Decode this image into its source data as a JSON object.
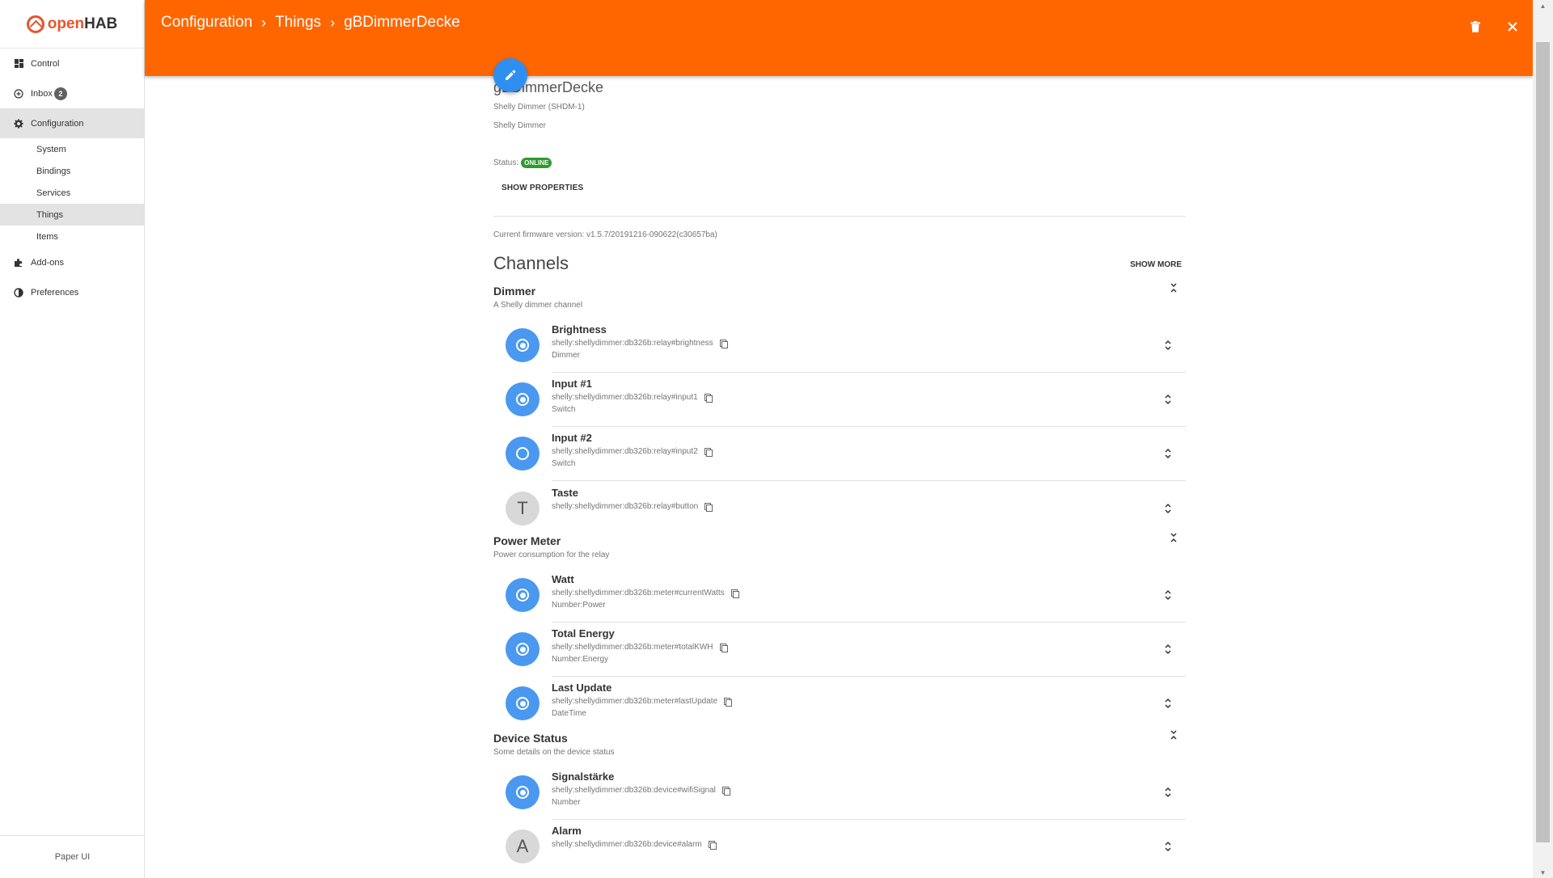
{
  "app": {
    "logo_text_open": "open",
    "logo_text_hab": "HAB",
    "footer": "Paper UI",
    "accent": "#ff6600",
    "primary_blue": "#4a98f0"
  },
  "sidebar": {
    "items": [
      {
        "label": "Control",
        "icon": "dashboard-icon"
      },
      {
        "label": "Inbox",
        "icon": "plus-circle-icon",
        "badge": "2"
      },
      {
        "label": "Configuration",
        "icon": "gear-icon"
      },
      {
        "label": "Add-ons",
        "icon": "puzzle-icon"
      },
      {
        "label": "Preferences",
        "icon": "contrast-icon"
      }
    ],
    "sub_items": [
      "System",
      "Bindings",
      "Services",
      "Things",
      "Items"
    ]
  },
  "header": {
    "crumbs": [
      "Configuration",
      "Things",
      "gBDimmerDecke"
    ],
    "separator": "›"
  },
  "thing": {
    "title": "gBDimmerDecke",
    "type_label": "Shelly Dimmer (SHDM-1)",
    "description": "Shelly Dimmer",
    "status_label": "Status:",
    "status": "ONLINE",
    "show_properties": "SHOW PROPERTIES",
    "firmware": "Current firmware version:  v1.5.7/20191216-090622(c30657ba)"
  },
  "channels": {
    "title": "Channels",
    "show_more": "SHOW MORE",
    "groups": [
      {
        "title": "Dimmer",
        "desc": "A Shelly dimmer channel",
        "items": [
          {
            "name": "Brightness",
            "uid": "shelly:shellydimmer:db326b:relay#brightness",
            "type": "Dimmer",
            "icon": "linked"
          },
          {
            "name": "Input #1",
            "uid": "shelly:shellydimmer:db326b:relay#input1",
            "type": "Switch",
            "icon": "linked"
          },
          {
            "name": "Input #2",
            "uid": "shelly:shellydimmer:db326b:relay#input2",
            "type": "Switch",
            "icon": "unlinked"
          },
          {
            "name": "Taste",
            "uid": "shelly:shellydimmer:db326b:relay#button",
            "type": "",
            "icon": "letter",
            "letter": "T"
          }
        ]
      },
      {
        "title": "Power Meter",
        "desc": "Power consumption for the relay",
        "items": [
          {
            "name": "Watt",
            "uid": "shelly:shellydimmer:db326b:meter#currentWatts",
            "type": "Number:Power",
            "icon": "linked"
          },
          {
            "name": "Total Energy",
            "uid": "shelly:shellydimmer:db326b:meter#totalKWH",
            "type": "Number:Energy",
            "icon": "linked"
          },
          {
            "name": "Last Update",
            "uid": "shelly:shellydimmer:db326b:meter#lastUpdate",
            "type": "DateTime",
            "icon": "linked"
          }
        ]
      },
      {
        "title": "Device Status",
        "desc": "Some details on the device status",
        "items": [
          {
            "name": "Signalstärke",
            "uid": "shelly:shellydimmer:db326b:device#wifiSignal",
            "type": "Number",
            "icon": "linked"
          },
          {
            "name": "Alarm",
            "uid": "shelly:shellydimmer:db326b:device#alarm",
            "type": "",
            "icon": "letter",
            "letter": "A"
          }
        ]
      }
    ]
  }
}
